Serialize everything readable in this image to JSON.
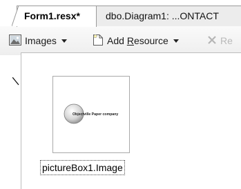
{
  "tabs": [
    {
      "label": "Form1.resx*",
      "active": true
    },
    {
      "label": "dbo.Diagram1: ...ONTACT",
      "active": false
    }
  ],
  "toolbar": {
    "images_label": "Images",
    "add_prefix": "Add ",
    "add_underlined": "R",
    "add_suffix": "esource",
    "remove_label": "Re"
  },
  "resource": {
    "logo_text": "Objectville Paper company",
    "caption": "pictureBox1.Image"
  }
}
